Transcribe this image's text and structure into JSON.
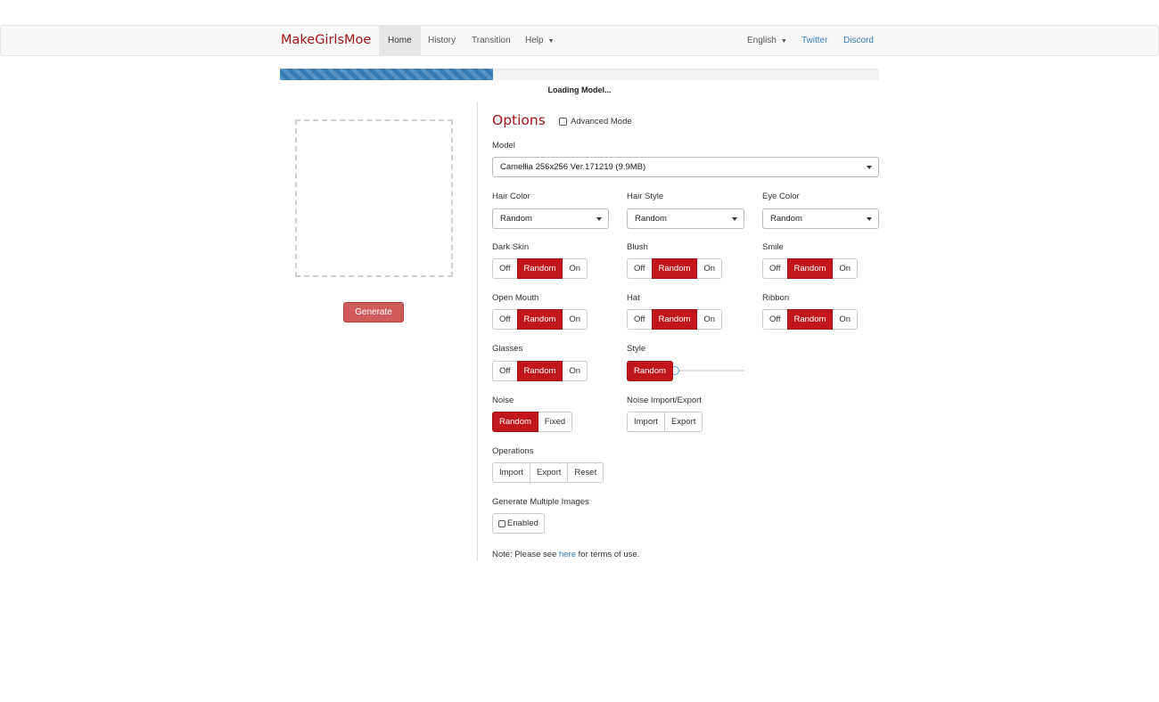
{
  "nav": {
    "brand": "MakeGirlsMoe",
    "home": "Home",
    "history": "History",
    "transition": "Transition",
    "help": "Help",
    "language": "English",
    "twitter": "Twitter",
    "discord": "Discord"
  },
  "progress": {
    "fraction": 0.355,
    "label": "Loading Model..."
  },
  "generate_label": "Generate",
  "options": {
    "title": "Options",
    "advanced_mode": "Advanced Mode",
    "model_label": "Model",
    "model_value": "Camellia 256x256 Ver.171219 (9.9MB)",
    "hair_color_label": "Hair Color",
    "hair_color_value": "Random",
    "hair_style_label": "Hair Style",
    "hair_style_value": "Random",
    "eye_color_label": "Eye Color",
    "eye_color_value": "Random",
    "tri_off": "Off",
    "tri_random": "Random",
    "tri_on": "On",
    "dark_skin": "Dark Skin",
    "blush": "Blush",
    "smile": "Smile",
    "open_mouth": "Open Mouth",
    "hat": "Hat",
    "ribbon": "Ribbon",
    "glasses": "Glasses",
    "style": "Style",
    "style_random": "Random",
    "style_slider_value": 0,
    "noise": "Noise",
    "noise_random": "Random",
    "noise_fixed": "Fixed",
    "noise_ie": "Noise Import/Export",
    "import": "Import",
    "export": "Export",
    "operations": "Operations",
    "reset": "Reset",
    "generate_multiple": "Generate Multiple Images",
    "enabled": "Enabled"
  },
  "note": {
    "prefix": "Note: Please see ",
    "link": "here",
    "suffix": " for terms of use."
  },
  "colors": {
    "accent": "#a31515",
    "selected": "#c0161c",
    "progress": "#337ab7",
    "generate": "#cf5c5a"
  },
  "icons": {
    "dropdown": "caret-down-icon",
    "checkbox": "checkbox-icon"
  }
}
